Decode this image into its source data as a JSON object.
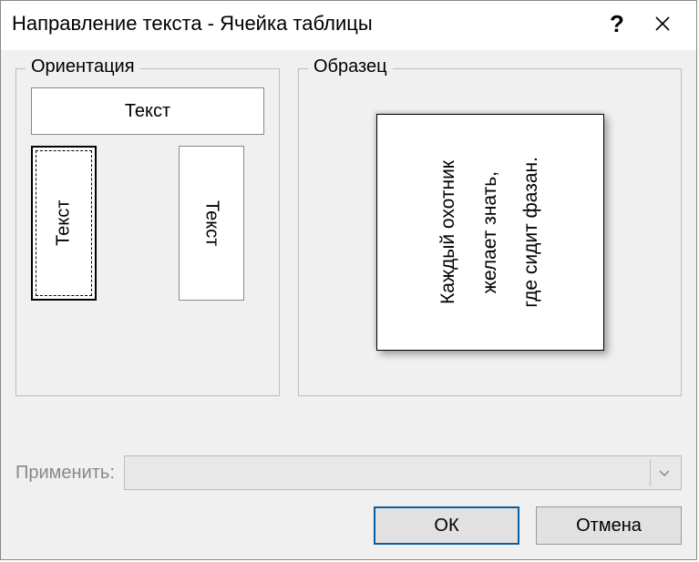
{
  "window": {
    "title": "Направление текста - Ячейка таблицы"
  },
  "orientation": {
    "legend": "Ориентация",
    "horizontal_label": "Текст",
    "vertical_left_label": "Текст",
    "vertical_right_label": "Текст",
    "selected": "vertical_left"
  },
  "preview": {
    "legend": "Образец",
    "line1": "Каждый охотник",
    "line2": "желает знать,",
    "line3": "где сидит фазан."
  },
  "apply": {
    "label": "Применить:",
    "value": ""
  },
  "buttons": {
    "ok": "ОК",
    "cancel": "Отмена"
  }
}
